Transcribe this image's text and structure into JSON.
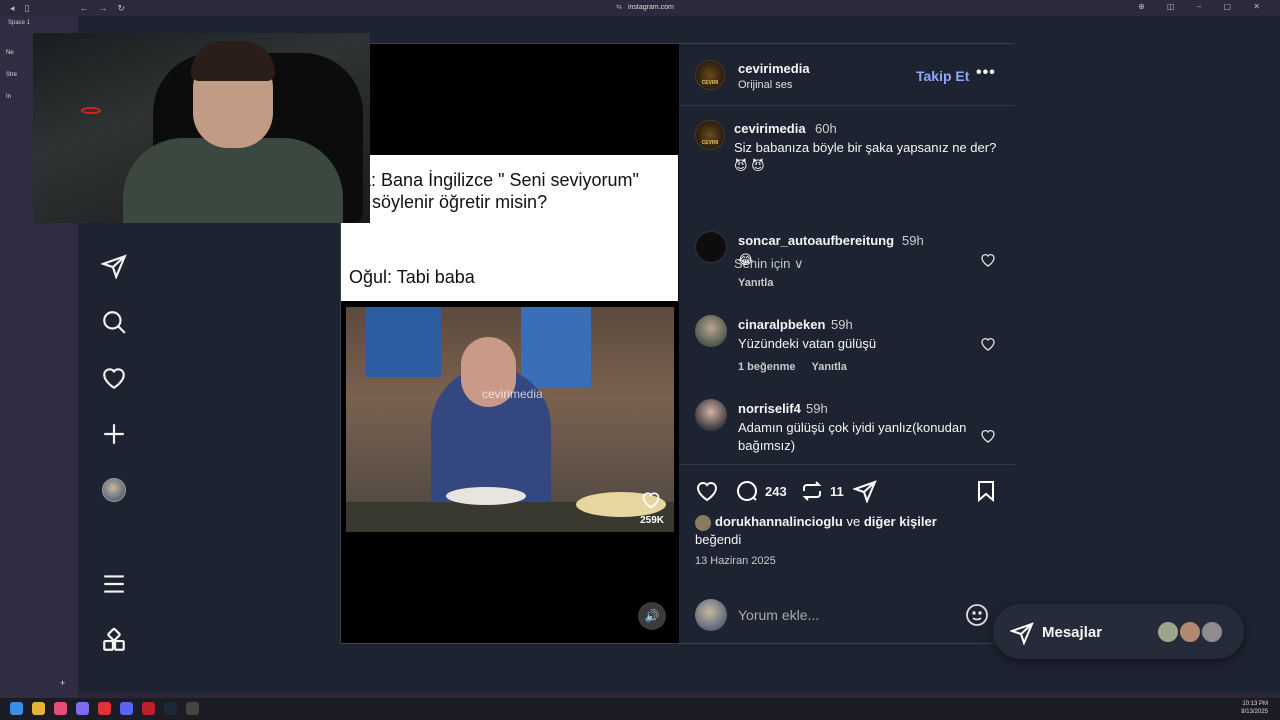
{
  "browser": {
    "url": "instagram.com",
    "space_label": "Space 1",
    "tab_items": [
      "Ne",
      "Stre",
      "In"
    ],
    "new_tab_glyph": "+",
    "window_buttons": "⊕ ◫ – ▢ ✕"
  },
  "nav": {
    "icons": [
      "send-icon",
      "search-icon",
      "heart-icon",
      "plus-icon",
      "avatar",
      "menu-icon",
      "apps-icon"
    ]
  },
  "media": {
    "caption_line1": "Baba: Bana İngilizce \" Seni seviyorum\" nasıl söylenir öğretir misin?",
    "caption_line2": "Oğul: Tabi baba",
    "watermark": "cevirimedia",
    "video_likes": "259K",
    "sound_icon": "🔊"
  },
  "header": {
    "username": "cevirimedia",
    "subtitle": "Orijinal ses",
    "follow_label": "Takip Et",
    "more_label": "•••",
    "avatar_text": "CEVIRI"
  },
  "caption": {
    "username": "cevirimedia",
    "time": "60h",
    "text": "Siz babanıza böyle bir şaka yapsanız ne der? 😈 😈",
    "for_you": "Senin için ∨"
  },
  "comments": [
    {
      "username": "soncar_autoaufbereitung",
      "time": "59h",
      "text": "😂",
      "likes": "",
      "reply": "Yanıtla"
    },
    {
      "username": "cinaralpbeken",
      "time": "59h",
      "text": "Yüzündeki vatan gülüşü",
      "likes": "1 beğenme",
      "reply": "Yanıtla"
    },
    {
      "username": "norriselif4",
      "time": "59h",
      "text": "Adamın gülüşü çok iyidi yanlız(konudan bağımsız)",
      "likes": "",
      "reply": ""
    }
  ],
  "actions": {
    "comment_count": "243",
    "repost_count": "11",
    "liked_by_user": "dorukhannalincioglu",
    "liked_and": "ve",
    "liked_others": "diğer kişiler",
    "liked_suffix": "beğendi",
    "date": "13 Haziran 2025",
    "add_comment_placeholder": "Yorum ekle..."
  },
  "messages": {
    "label": "Mesajlar"
  },
  "taskbar": {
    "time": "10:13 PM",
    "date": "8/13/2025"
  },
  "colors": {
    "accent_follow": "#8ea8ff",
    "panel_bg": "#1e2331",
    "page_bg": "#2a2638"
  }
}
